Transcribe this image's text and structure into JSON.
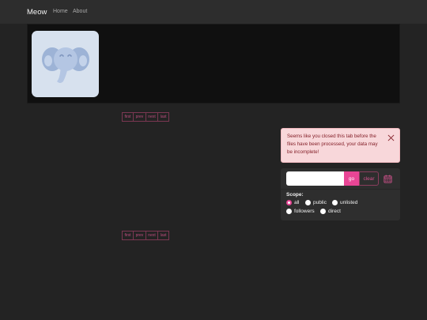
{
  "nav": {
    "brand": "Meow",
    "links": [
      "Home",
      "About"
    ]
  },
  "profile": {
    "avatar_icon": "elephant-icon"
  },
  "pagination": {
    "labels": [
      "first",
      "prev",
      "next",
      "last"
    ]
  },
  "alert": {
    "message": "Seems like you closed this tab before the files have been processed, your data may be incomplete!"
  },
  "search": {
    "value": "",
    "go_label": "go",
    "clear_label": "clear"
  },
  "scope": {
    "label": "Scope:",
    "options": [
      "all",
      "public",
      "unlisted",
      "followers",
      "direct"
    ],
    "selected": "all"
  },
  "colors": {
    "accent": "#e84595",
    "background": "#232323",
    "alert_bg": "#f8d7da"
  }
}
